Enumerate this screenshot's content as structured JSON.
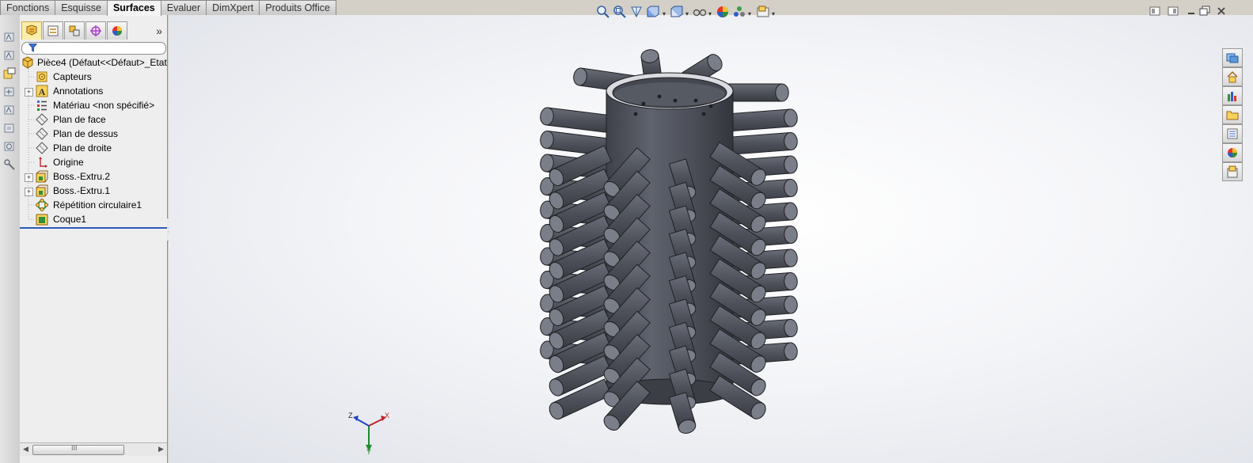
{
  "command_manager": {
    "tabs": [
      {
        "label": "Fonctions",
        "active": false
      },
      {
        "label": "Esquisse",
        "active": false
      },
      {
        "label": "Surfaces",
        "active": true
      },
      {
        "label": "Evaluer",
        "active": false
      },
      {
        "label": "DimXpert",
        "active": false
      },
      {
        "label": "Produits Office",
        "active": false
      }
    ]
  },
  "feature_manager": {
    "panel_tabs": [
      "featuremanager-tree-icon",
      "propertymanager-icon",
      "configurationmanager-icon",
      "dimxpertmanager-icon",
      "displaymanager-icon"
    ],
    "more_chevron": "»",
    "root": "Pièce4  (Défaut<<Défaut>_Etat",
    "items": [
      {
        "label": "Capteurs",
        "icon": "sensors-icon",
        "expandable": false
      },
      {
        "label": "Annotations",
        "icon": "annotations-icon",
        "expandable": true
      },
      {
        "label": "Matériau <non spécifié>",
        "icon": "material-icon",
        "expandable": false
      },
      {
        "label": "Plan de face",
        "icon": "plane-icon",
        "expandable": false
      },
      {
        "label": "Plan de dessus",
        "icon": "plane-icon",
        "expandable": false
      },
      {
        "label": "Plan de droite",
        "icon": "plane-icon",
        "expandable": false
      },
      {
        "label": "Origine",
        "icon": "origin-icon",
        "expandable": false
      },
      {
        "label": "Boss.-Extru.2",
        "icon": "extrude-icon",
        "expandable": true
      },
      {
        "label": "Boss.-Extru.1",
        "icon": "extrude-icon",
        "expandable": true
      },
      {
        "label": "Répétition circulaire1",
        "icon": "circular-pattern-icon",
        "expandable": false
      },
      {
        "label": "Coque1",
        "icon": "shell-icon",
        "expandable": false
      }
    ],
    "scroll_thumb_label": "III"
  },
  "view_toolbar": {
    "icons": [
      "zoom-to-fit-icon",
      "zoom-to-area-icon",
      "previous-view-icon",
      "section-view-icon",
      "view-orientation-icon",
      "display-style-icon",
      "hide-show-items-icon",
      "edit-appearance-icon",
      "apply-scene-icon",
      "view-settings-icon"
    ]
  },
  "triad": {
    "x": "X",
    "y": "Y",
    "z": "Z"
  },
  "colors": {
    "model": "#4b4e57",
    "model_light": "#6d717b",
    "accent_blue": "#2d5bb8"
  }
}
